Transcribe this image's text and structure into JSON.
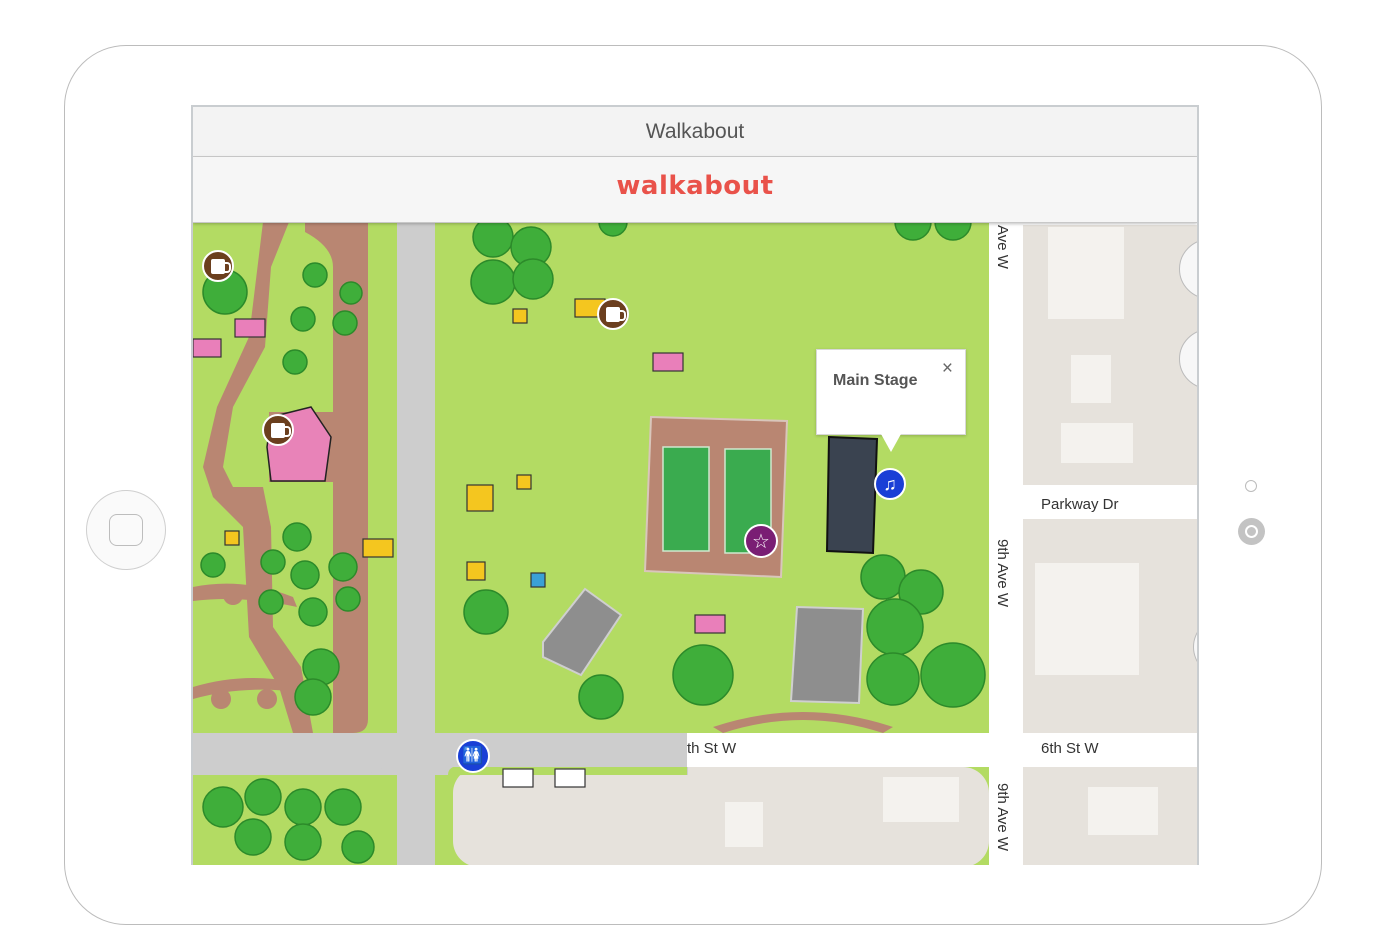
{
  "window": {
    "title": "Walkabout"
  },
  "app": {
    "logo_text": "walkabout",
    "brand_color": "#e9524a"
  },
  "map": {
    "streets": {
      "parkway": "Parkway Dr",
      "sixth_left": "th St W",
      "sixth_right": "6th St W",
      "ninth_top": "Ave W",
      "ninth_mid": "9th Ave W",
      "ninth_bottom": "9th Ave W"
    },
    "popup": {
      "title": "Main Stage",
      "close_glyph": "×"
    },
    "pin_icons": {
      "beer": "beer-mug-icon",
      "music": "music-note-icon",
      "featured": "star-icon",
      "restroom": "restroom-icon"
    },
    "pin_glyphs": {
      "music": "♫",
      "star": "☆",
      "restroom": "🚻"
    },
    "colors": {
      "grass": "#b3db63",
      "path": "#b98672",
      "road": "#cdcdcd",
      "block": "#e6e2dc",
      "tree": "#3fae3a",
      "court": "#3aab4f"
    }
  }
}
